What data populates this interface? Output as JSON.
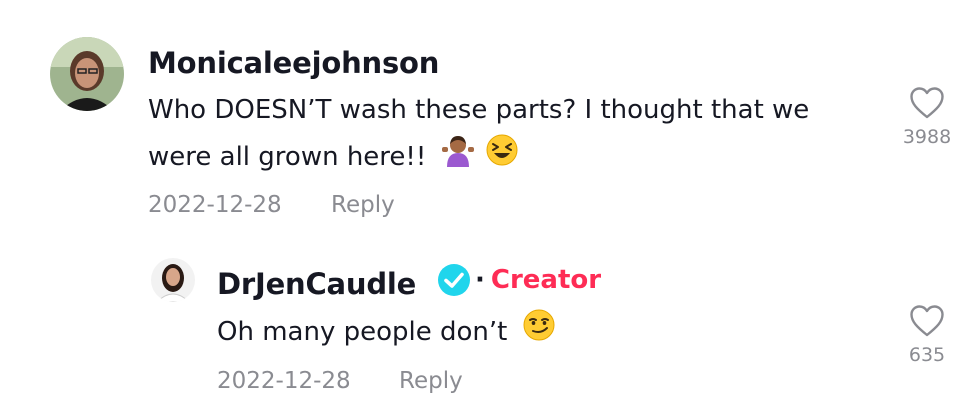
{
  "comments": [
    {
      "username": "Monicaleejohnson",
      "text_line1": "Who DOESN’T wash these parts? I thought that we",
      "text_line2": "were all grown here!!",
      "emojis": [
        "person-shrugging-emoji",
        "squinting-laughing-face-emoji"
      ],
      "date": "2022-12-28",
      "reply_label": "Reply",
      "likes": "3988"
    }
  ],
  "reply": {
    "username": "DrJenCaudle",
    "verified": true,
    "separator": "·",
    "creator_label": "Creator",
    "text": "Oh many people don’t",
    "emoji": "smirking-face-emoji",
    "date": "2022-12-28",
    "reply_label": "Reply",
    "likes": "635"
  },
  "colors": {
    "text": "#161823",
    "muted": "#8a8b91",
    "creator": "#fe2c55",
    "verified": "#20d5ec"
  }
}
